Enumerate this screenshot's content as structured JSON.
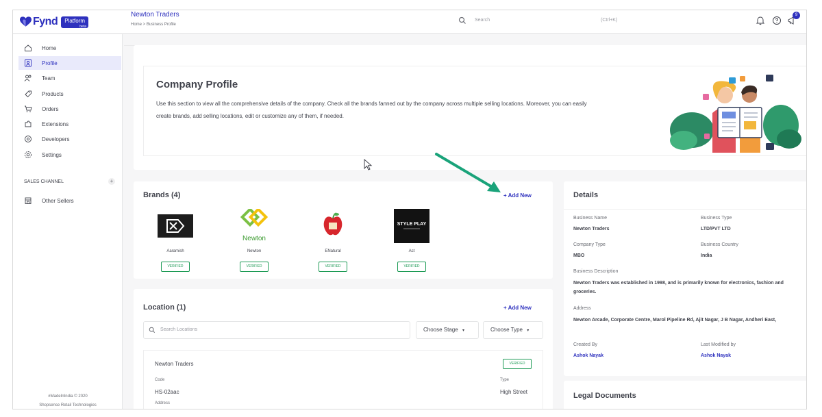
{
  "brand": {
    "logo_text": "Fynd",
    "platform_badge": "Platform",
    "beta_badge": "beta"
  },
  "header": {
    "title": "Newton Traders",
    "breadcrumb": "Home  >  Business Profile",
    "search_placeholder": "Search",
    "search_shortcut": "(Ctrl+K)",
    "notification_count": "9"
  },
  "sidebar": {
    "items": [
      {
        "label": "Home",
        "icon": "home-icon"
      },
      {
        "label": "Profile",
        "icon": "profile-icon",
        "active": true
      },
      {
        "label": "Team",
        "icon": "team-icon"
      },
      {
        "label": "Products",
        "icon": "products-icon"
      },
      {
        "label": "Orders",
        "icon": "orders-icon"
      },
      {
        "label": "Extensions",
        "icon": "extensions-icon"
      },
      {
        "label": "Developers",
        "icon": "developers-icon"
      },
      {
        "label": "Settings",
        "icon": "settings-icon"
      }
    ],
    "sales_channel_label": "SALES CHANNEL",
    "sales_channel_add": "+",
    "other_sellers": "Other Sellers",
    "footer_line1": "#MadeInIndia © 2020",
    "footer_line2": "Shopsense Retail Technologies"
  },
  "profile": {
    "title": "Company Profile",
    "description": "Use this section to view all the comprehensive details of the company. Check all the brands fanned out by the company across multiple selling locations. Moreover, you can easily create brands, add selling locations, edit or customize any of them, if needed."
  },
  "brands": {
    "title": "Brands (4)",
    "add_new": "+ Add New",
    "items": [
      {
        "name": "Aaramish",
        "status": "VERIFIED",
        "logo_text": ""
      },
      {
        "name": "Newton",
        "status": "VERIFIED",
        "logo_text": "Newton"
      },
      {
        "name": "ENatural",
        "status": "VERIFIED",
        "logo_text": ""
      },
      {
        "name": "Act",
        "status": "VERIFIED",
        "logo_text": "STYLE PLAY"
      }
    ]
  },
  "location": {
    "title": "Location (1)",
    "add_new": "+ Add New",
    "search_placeholder": "Search Locations",
    "stage_dropdown": "Choose Stage",
    "type_dropdown": "Choose Type",
    "item": {
      "name": "Newton Traders",
      "status": "VERIFIED",
      "code_label": "Code",
      "code": "HS-02aac",
      "type_label": "Type",
      "type": "High Street",
      "address_label": "Address"
    }
  },
  "details": {
    "title": "Details",
    "business_name_label": "Business Name",
    "business_name": "Newton Traders",
    "business_type_label": "Business Type",
    "business_type": "LTD/PVT LTD",
    "company_type_label": "Company Type",
    "company_type": "MBO",
    "business_country_label": "Business Country",
    "business_country": "India",
    "business_description_label": "Business Description",
    "business_description": "Newton Traders was established in 1998, and is primarily known for electronics, fashion and groceries.",
    "address_label": "Address",
    "address": "Newton Arcade, Corporate Centre, Marol Pipeline Rd, Ajit Nagar, J B Nagar, Andheri East,",
    "created_by_label": "Created By",
    "created_by": "Ashok Nayak",
    "last_modified_label": "Last Modified by",
    "last_modified_by": "Ashok Nayak"
  },
  "legal": {
    "title": "Legal Documents"
  },
  "colors": {
    "accent": "#2e31be",
    "verified": "#1c9a55",
    "arrow": "#1aa37a"
  }
}
